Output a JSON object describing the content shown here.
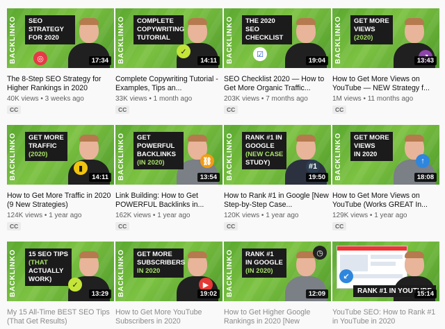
{
  "brand_text": "BACKLINKO",
  "cc_label": "CC",
  "videos": [
    {
      "badge_lines": [
        "SEO STRATEGY",
        "FOR 2020"
      ],
      "accent_index": -1,
      "icon": "target-icon",
      "duration": "17:34",
      "title": "The 8-Step SEO Strategy for Higher Rankings in 2020",
      "meta": "40K views • 3 weeks ago"
    },
    {
      "badge_lines": [
        "COMPLETE",
        "COPYWRITING",
        "TUTORIAL"
      ],
      "accent_index": -1,
      "icon": "check-icon",
      "duration": "14:11",
      "title": "Complete Copywriting Tutorial - Examples, Tips an...",
      "meta": "33K views • 1 month ago"
    },
    {
      "badge_lines": [
        "THE 2020 SEO",
        "CHECKLIST"
      ],
      "accent_index": -1,
      "icon": "checklist-icon",
      "duration": "19:04",
      "title": "SEO Checklist 2020 — How to Get More Organic Traffic...",
      "meta": "203K views • 7 months ago"
    },
    {
      "badge_lines": [
        "GET MORE",
        "VIEWS",
        "(2020)"
      ],
      "accent_index": 2,
      "icon": "trend-up-icon",
      "duration": "13:43",
      "title": "How to Get More Views on YouTube — NEW Strategy f...",
      "meta": "1M views • 11 months ago"
    },
    {
      "badge_lines": [
        "GET MORE",
        "TRAFFIC",
        "(2020)"
      ],
      "accent_index": 2,
      "icon": "bar-chart-icon",
      "duration": "14:11",
      "title": "How to Get More Traffic in 2020 (9 New Strategies)",
      "meta": "124K views • 1 year ago"
    },
    {
      "badge_lines": [
        "GET POWERFUL",
        "BACKLINKS",
        "(IN 2020)"
      ],
      "accent_index": 2,
      "icon": "link-icon",
      "duration": "13:54",
      "title": "Link Building: How to Get POWERFUL Backlinks in...",
      "meta": "162K views • 1 year ago"
    },
    {
      "badge_lines": [
        "RANK #1 IN",
        "GOOGLE",
        "(NEW CASE",
        "STUDY)"
      ],
      "accent_index": 2,
      "icon": "number-one-icon",
      "duration": "19:50",
      "title": "How to Rank #1 in Google [New Step-by-Step Case...",
      "meta": "120K views • 1 year ago"
    },
    {
      "badge_lines": [
        "GET MORE",
        "VIEWS",
        "IN 2020"
      ],
      "accent_index": -1,
      "icon": "arrow-up-icon",
      "duration": "18:08",
      "title": "How to Get More Views on YouTube (Works GREAT In...",
      "meta": "129K views • 1 year ago"
    },
    {
      "badge_lines": [
        "15 SEO TIPS",
        "(THAT",
        "ACTUALLY",
        "WORK)"
      ],
      "accent_index": 1,
      "icon": "check-icon",
      "duration": "13:29",
      "title": "My 15 All-Time BEST SEO Tips (That Get Results)",
      "meta": ""
    },
    {
      "badge_lines": [
        "GET MORE",
        "SUBSCRIBERS",
        "IN 2020"
      ],
      "accent_index": 2,
      "icon": "play-icon",
      "duration": "19:02",
      "title": "How to Get More YouTube Subscribers in 2020",
      "meta": ""
    },
    {
      "badge_lines": [
        "RANK #1",
        "IN GOOGLE",
        "(IN 2020)"
      ],
      "accent_index": 2,
      "icon": "clock-icon",
      "duration": "12:09",
      "title": "How to Get Higher Google Rankings in 2020 [New",
      "meta": ""
    },
    {
      "badge_lines": [
        "RANK #1 IN YOUTUBE"
      ],
      "accent_index": -1,
      "icon": "arrow-icon",
      "duration": "15:14",
      "title": "YouTube SEO: How to Rank #1 in YouTube in 2020",
      "meta": ""
    }
  ]
}
